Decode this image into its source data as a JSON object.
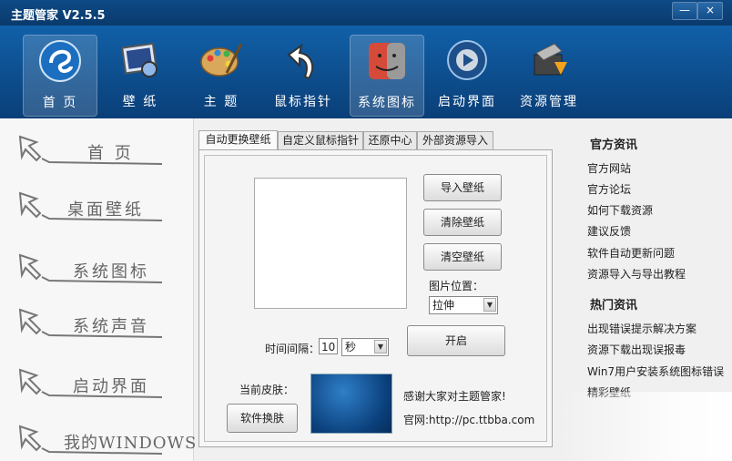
{
  "window": {
    "title": "主题管家 V2.5.5",
    "min_glyph": "—",
    "close_glyph": "×"
  },
  "nav": [
    {
      "label": "首 页",
      "icon": "home-icon",
      "active": true
    },
    {
      "label": "壁 纸",
      "icon": "wallpaper-icon",
      "active": false
    },
    {
      "label": "主 题",
      "icon": "palette-icon",
      "active": false
    },
    {
      "label": "鼠标指针",
      "icon": "cursor-arrow-icon",
      "active": false
    },
    {
      "label": "系统图标",
      "icon": "finder-icon",
      "active": true
    },
    {
      "label": "启动界面",
      "icon": "media-disc-icon",
      "active": false
    },
    {
      "label": "资源管理",
      "icon": "tools-folder-icon",
      "active": false
    }
  ],
  "sidebar": {
    "items": [
      {
        "label": "首 页"
      },
      {
        "label": "桌面壁纸"
      },
      {
        "label": "系统图标"
      },
      {
        "label": "系统声音"
      },
      {
        "label": "启动界面"
      },
      {
        "label": "我的WINDOWS"
      }
    ]
  },
  "tabs": [
    {
      "label": "自动更换壁纸",
      "active": true
    },
    {
      "label": "自定义鼠标指针",
      "active": false
    },
    {
      "label": "还原中心",
      "active": false
    },
    {
      "label": "外部资源导入",
      "active": false
    }
  ],
  "wallpaper_panel": {
    "import_button": "导入壁纸",
    "clear_button": "清除壁纸",
    "empty_button": "清空壁纸",
    "position_label": "图片位置：",
    "position_value": "拉伸",
    "interval_label": "时间间隔：",
    "interval_value": "10",
    "interval_unit": "秒",
    "start_button": "开启"
  },
  "skin": {
    "label": "当前皮肤：",
    "switch_button": "软件换肤",
    "thanks": "感谢大家对主题管家!",
    "site": "官网:http://pc.ttbba.com"
  },
  "right": {
    "official_title": "官方资讯",
    "official_links": [
      "官方网站",
      "官方论坛",
      "如何下载资源",
      "建议反馈",
      "软件自动更新问题",
      "资源导入与导出教程"
    ],
    "hot_title": "热门资讯",
    "hot_links": [
      "出现错误提示解决方案",
      "资源下载出现误报毒",
      "Win7用户安装系统图标错误",
      "精彩壁纸"
    ]
  },
  "colors": {
    "titlebar": "#0e4a86",
    "toolbar": "#1160a8",
    "panel": "#f0f0f0"
  }
}
